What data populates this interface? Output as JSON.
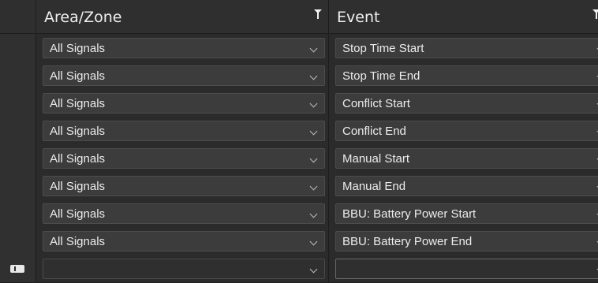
{
  "columns": {
    "area_zone": {
      "title": "Area/Zone"
    },
    "event": {
      "title": "Event"
    }
  },
  "icons": {
    "filter": "filter-icon",
    "dropdown": "chevron-down-icon",
    "new_row": "new-row-icon"
  },
  "rows": [
    {
      "area": "All Signals",
      "event": "Stop Time Start"
    },
    {
      "area": "All Signals",
      "event": "Stop Time End"
    },
    {
      "area": "All Signals",
      "event": "Conflict Start"
    },
    {
      "area": "All Signals",
      "event": "Conflict End"
    },
    {
      "area": "All Signals",
      "event": "Manual Start"
    },
    {
      "area": "All Signals",
      "event": "Manual End"
    },
    {
      "area": "All Signals",
      "event": "BBU: Battery Power Start"
    },
    {
      "area": "All Signals",
      "event": "BBU: Battery Power End"
    }
  ],
  "new_row": {
    "area": "",
    "event": ""
  }
}
